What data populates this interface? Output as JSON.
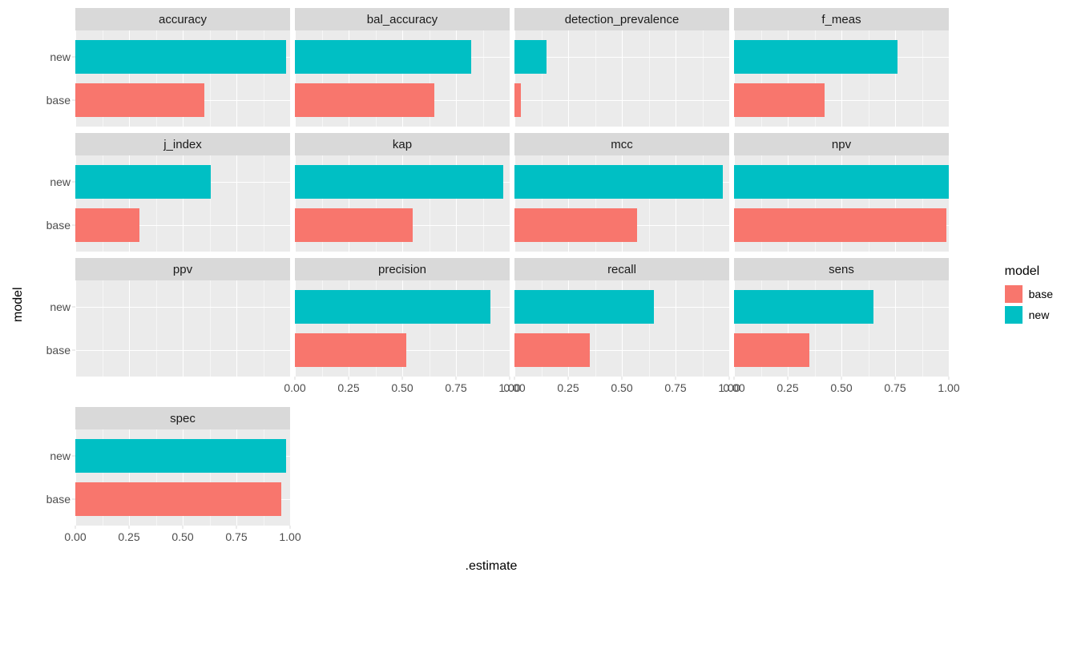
{
  "chart_data": {
    "type": "bar",
    "xlabel": ".estimate",
    "ylabel": "model",
    "xlim": [
      0,
      1
    ],
    "x_ticks": [
      0.0,
      0.25,
      0.5,
      0.75,
      1.0
    ],
    "x_tick_labels": [
      "0.00",
      "0.25",
      "0.50",
      "0.75",
      "1.00"
    ],
    "y_categories": [
      "new",
      "base"
    ],
    "legend_title": "model",
    "legend_items": [
      {
        "name": "base",
        "color": "#F8766D"
      },
      {
        "name": "new",
        "color": "#00BFC4"
      }
    ],
    "facets": [
      {
        "name": "accuracy",
        "base": 0.6,
        "new": 0.98
      },
      {
        "name": "bal_accuracy",
        "base": 0.65,
        "new": 0.82
      },
      {
        "name": "detection_prevalence",
        "base": 0.03,
        "new": 0.15
      },
      {
        "name": "f_meas",
        "base": 0.42,
        "new": 0.76
      },
      {
        "name": "j_index",
        "base": 0.3,
        "new": 0.63
      },
      {
        "name": "kap",
        "base": 0.55,
        "new": 0.97
      },
      {
        "name": "mcc",
        "base": 0.57,
        "new": 0.97
      },
      {
        "name": "npv",
        "base": 0.99,
        "new": 1.0
      },
      {
        "name": "ppv",
        "base": 0.0,
        "new": 0.0
      },
      {
        "name": "precision",
        "base": 0.52,
        "new": 0.91
      },
      {
        "name": "recall",
        "base": 0.35,
        "new": 0.65
      },
      {
        "name": "sens",
        "base": 0.35,
        "new": 0.65
      },
      {
        "name": "spec",
        "base": 0.96,
        "new": 0.98
      }
    ],
    "layout_rows": [
      [
        0,
        1,
        2,
        3
      ],
      [
        4,
        5,
        6,
        7
      ],
      [
        8,
        9,
        10,
        11
      ],
      [
        12
      ]
    ]
  }
}
